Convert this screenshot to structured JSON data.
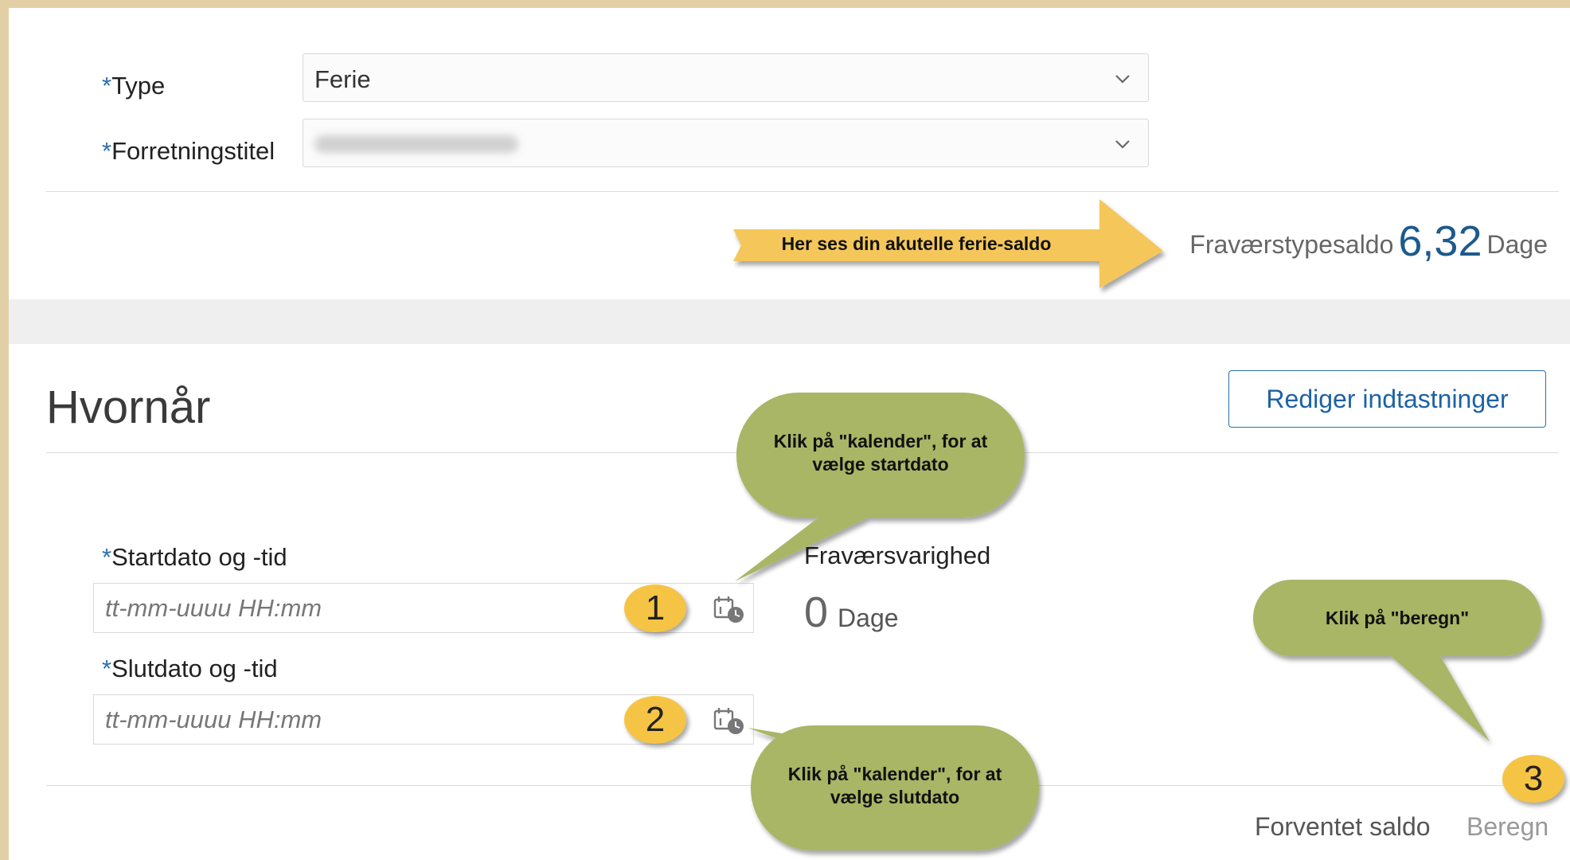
{
  "form": {
    "type_label": "Type",
    "type_value": "Ferie",
    "title_label": "Forretningstitel",
    "required_mark": "*"
  },
  "balance": {
    "label": "Fraværstypesaldo",
    "value": "6,32",
    "unit": "Dage"
  },
  "when": {
    "title": "Hvornår",
    "edit_button": "Rediger indtastninger",
    "start_label": "Startdato og -tid",
    "start_placeholder": "tt-mm-uuuu HH:mm",
    "end_label": "Slutdato og -tid",
    "end_placeholder": "tt-mm-uuuu HH:mm",
    "duration_label": "Fraværsvarighed",
    "duration_value": "0",
    "duration_unit": "Dage"
  },
  "footer": {
    "expected_balance": "Forventet saldo",
    "calculate": "Beregn"
  },
  "annotations": {
    "arrow_text": "Her ses din akutelle ferie-saldo",
    "callout_start": "Klik på \"kalender\", for at vælge startdato",
    "callout_end": "Klik på \"kalender\", for at vælge slutdato",
    "callout_calc": "Klik på \"beregn\"",
    "badge_1": "1",
    "badge_2": "2",
    "badge_3": "3"
  },
  "colors": {
    "accent": "#1d5a8c",
    "arrow": "#f5c75a",
    "callout": "#a8b665",
    "badge": "#f6c444"
  }
}
